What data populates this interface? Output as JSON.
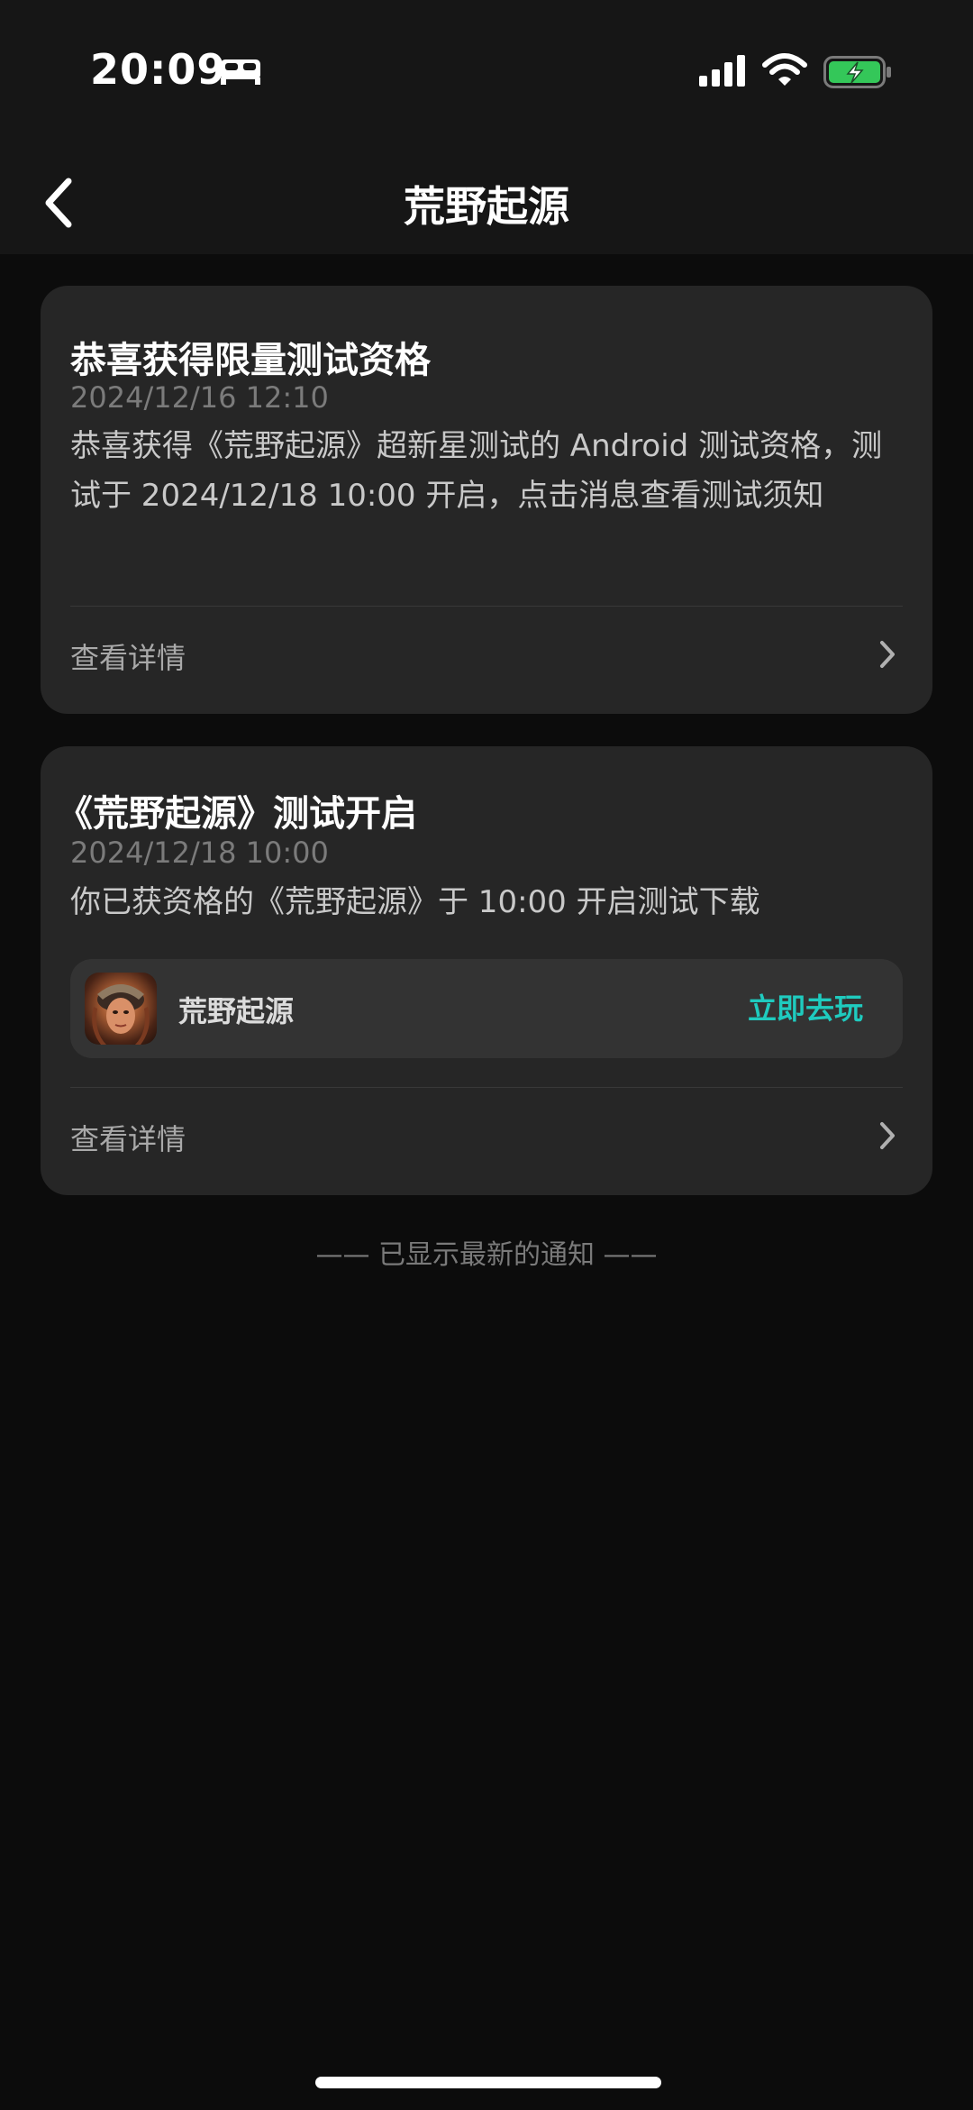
{
  "status_bar": {
    "time": "20:09",
    "icons": [
      "bed-icon",
      "signal-icon",
      "wifi-icon",
      "battery-charging-icon"
    ],
    "battery_color": "#34c759"
  },
  "header": {
    "back_icon": "chevron-left-icon",
    "title": "荒野起源"
  },
  "notifications": [
    {
      "title": "恭喜获得限量测试资格",
      "timestamp": "2024/12/16 12:10",
      "body": "恭喜获得《荒野起源》超新星测试的 Android 测试资格，测试于 2024/12/18 10:00 开启，点击消息查看测试须知",
      "detail_label": "查看详情"
    },
    {
      "title": "《荒野起源》测试开启",
      "timestamp": "2024/12/18 10:00",
      "body": "你已获资格的《荒野起源》于 10:00 开启测试下载",
      "app": {
        "name": "荒野起源",
        "action_label": "立即去玩"
      },
      "detail_label": "查看详情"
    }
  ],
  "footer_note": "—— 已显示最新的通知 ——",
  "accent_color": "#1fcbbf"
}
